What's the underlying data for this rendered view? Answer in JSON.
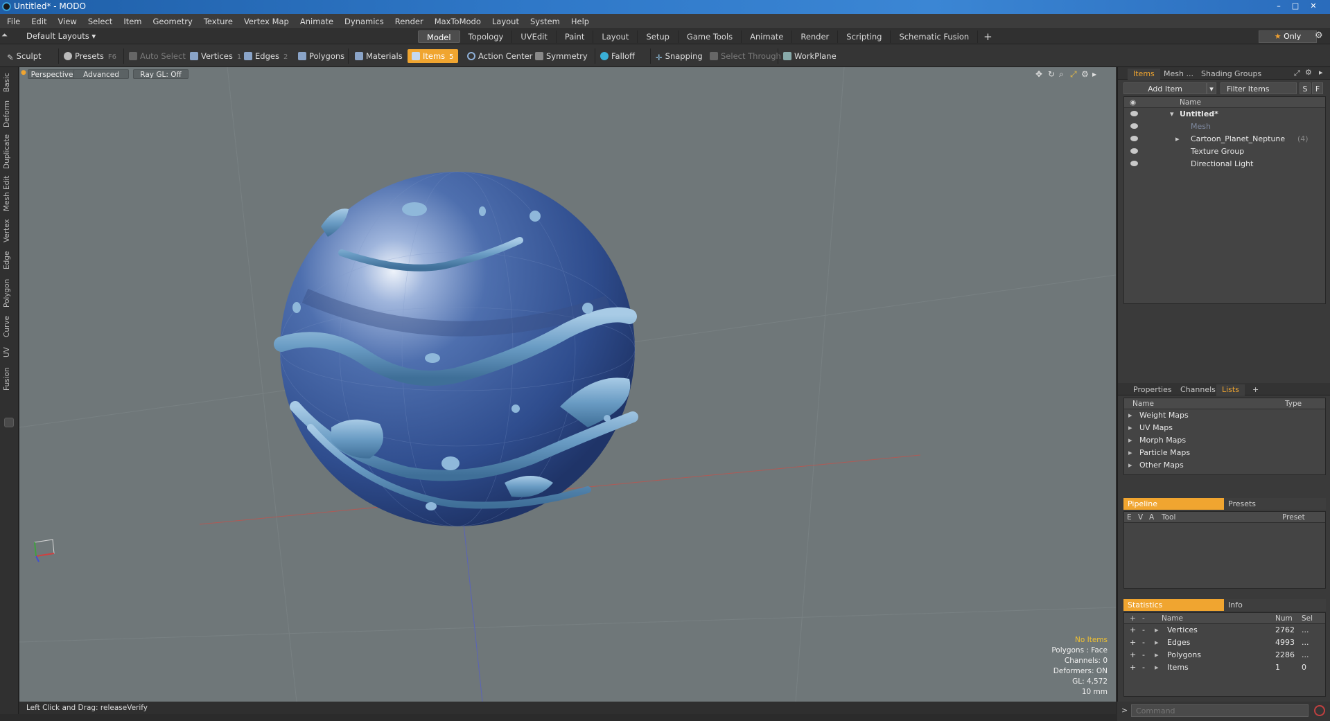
{
  "window": {
    "title": "Untitled* - MODO",
    "min_label": "–",
    "max_label": "□",
    "close_label": "✕"
  },
  "menu": [
    "File",
    "Edit",
    "View",
    "Select",
    "Item",
    "Geometry",
    "Texture",
    "Vertex Map",
    "Animate",
    "Dynamics",
    "Render",
    "MaxToModo",
    "Layout",
    "System",
    "Help"
  ],
  "layout_selector": "Default Layouts ▾",
  "layout_tabs": [
    {
      "label": "Model",
      "active": true
    },
    {
      "label": "Topology"
    },
    {
      "label": "UVEdit"
    },
    {
      "label": "Paint"
    },
    {
      "label": "Layout"
    },
    {
      "label": "Setup"
    },
    {
      "label": "Game Tools"
    },
    {
      "label": "Animate"
    },
    {
      "label": "Render"
    },
    {
      "label": "Scripting"
    },
    {
      "label": "Schematic Fusion"
    }
  ],
  "layout_add": "+",
  "only_button": "Only",
  "toolbar": {
    "sculpt": "Sculpt",
    "presets": "Presets",
    "presets_key": "F6",
    "auto_select": "Auto Select",
    "vertices": "Vertices",
    "vertices_count": "1",
    "edges": "Edges",
    "edges_count": "2",
    "polygons": "Polygons",
    "materials": "Materials",
    "items": "Items",
    "items_count": "5",
    "action_center": "Action Center",
    "symmetry": "Symmetry",
    "falloff": "Falloff",
    "snapping": "Snapping",
    "select_through": "Select Through",
    "workplane": "WorkPlane"
  },
  "left_tabs": [
    "Basic",
    "Deform",
    "Duplicate",
    "Mesh Edit",
    "Vertex",
    "Edge",
    "Polygon",
    "Curve",
    "UV",
    "Fusion"
  ],
  "viewport": {
    "perspective": "Perspective",
    "advanced": "Advanced",
    "raygl": "Ray GL: Off",
    "stats": {
      "no_items": "No Items",
      "polygons": "Polygons : Face",
      "channels": "Channels: 0",
      "deformers": "Deformers: ON",
      "gl": "GL: 4,572",
      "scale": "10 mm"
    }
  },
  "status_bar": {
    "text": "Left Click and Drag:   releaseVerify"
  },
  "items_panel": {
    "tabs": [
      {
        "label": "Items",
        "active": true
      },
      {
        "label": "Mesh ..."
      },
      {
        "label": "Shading"
      },
      {
        "label": "Groups"
      }
    ],
    "add_item": "Add Item",
    "filter_items": "Filter Items",
    "s_btn": "S",
    "f_btn": "F",
    "name_header": "Name",
    "tree": [
      {
        "label": "Untitled*",
        "bold": true
      },
      {
        "label": "Mesh",
        "dim": true
      },
      {
        "label": "Cartoon_Planet_Neptune",
        "suffix": "(4)"
      },
      {
        "label": "Texture Group"
      },
      {
        "label": "Directional Light"
      }
    ]
  },
  "lists_panel": {
    "tabs": [
      {
        "label": "Properties"
      },
      {
        "label": "Channels"
      },
      {
        "label": "Lists",
        "active": true
      },
      {
        "label": "+"
      }
    ],
    "col_name": "Name",
    "col_type": "Type",
    "rows": [
      "Weight Maps",
      "UV Maps",
      "Morph Maps",
      "Particle Maps",
      "Other Maps"
    ]
  },
  "pipeline_panel": {
    "tab_pipeline": "Pipeline",
    "tab_presets": "Presets",
    "col_e": "E",
    "col_v": "V",
    "col_a": "A",
    "col_tool": "Tool",
    "col_preset": "Preset"
  },
  "statistics_panel": {
    "tab_statistics": "Statistics",
    "tab_info": "Info",
    "col_plus": "+",
    "col_minus": "-",
    "col_name": "Name",
    "col_num": "Num",
    "col_sel": "Sel",
    "rows": [
      {
        "name": "Vertices",
        "num": "2762",
        "sel": "..."
      },
      {
        "name": "Edges",
        "num": "4993",
        "sel": "..."
      },
      {
        "name": "Polygons",
        "num": "2286",
        "sel": "..."
      },
      {
        "name": "Items",
        "num": "1",
        "sel": "0"
      }
    ]
  },
  "command": {
    "placeholder": "Command",
    "prompt": ">"
  },
  "colors": {
    "accent_orange": "#f0a530",
    "viewport_bg": "#6f7779",
    "planet_blue": "#3d5d9c",
    "band_blue": "#6c9ec4"
  }
}
